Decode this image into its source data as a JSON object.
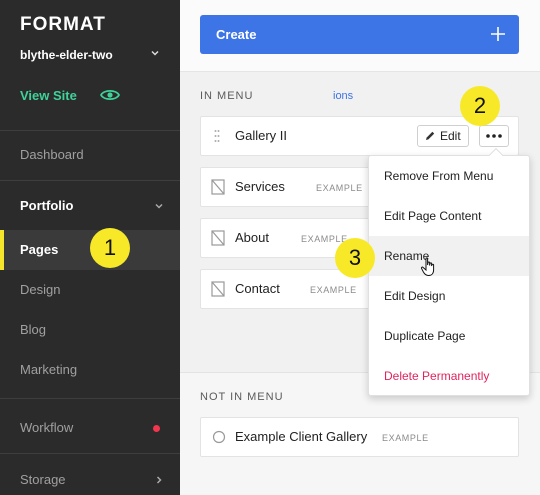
{
  "sidebar": {
    "logo": "FORMAT",
    "site_name": "blythe-elder-two",
    "view_site": "View Site",
    "items": [
      {
        "label": "Dashboard"
      },
      {
        "label": "Portfolio"
      },
      {
        "label": "Pages"
      },
      {
        "label": "Design"
      },
      {
        "label": "Blog"
      },
      {
        "label": "Marketing"
      },
      {
        "label": "Workflow"
      },
      {
        "label": "Storage"
      }
    ]
  },
  "main": {
    "create_label": "Create",
    "in_menu_label": "IN MENU",
    "options_link": "ions",
    "in_menu_rows": [
      {
        "title": "Gallery II",
        "tag": ""
      },
      {
        "title": "Services",
        "tag": "EXAMPLE"
      },
      {
        "title": "About",
        "tag": "EXAMPLE"
      },
      {
        "title": "Contact",
        "tag": "EXAMPLE"
      }
    ],
    "edit_label": "Edit",
    "not_in_menu_label": "NOT IN MENU",
    "not_in_menu_rows": [
      {
        "title": "Example Client Gallery",
        "tag": "EXAMPLE"
      }
    ]
  },
  "dropdown": {
    "items": [
      {
        "label": "Remove From Menu"
      },
      {
        "label": "Edit Page Content"
      },
      {
        "label": "Rename"
      },
      {
        "label": "Edit Design"
      },
      {
        "label": "Duplicate Page"
      },
      {
        "label": "Delete Permanently"
      }
    ]
  },
  "badges": {
    "step1": "1",
    "step2": "2",
    "step3": "3"
  },
  "colors": {
    "sidebar_bg": "#2b2b2b",
    "accent_blue": "#3d74e6",
    "view_site_green": "#3fd29a",
    "badge_yellow": "#f7e928",
    "danger": "#e0245e"
  },
  "icons": [
    "chevron-down-icon",
    "eye-icon",
    "plus-icon",
    "drag-handle-icon",
    "page-icon",
    "pencil-icon",
    "more-icon",
    "circle-icon",
    "chevron-right-icon",
    "hand-cursor-icon"
  ]
}
